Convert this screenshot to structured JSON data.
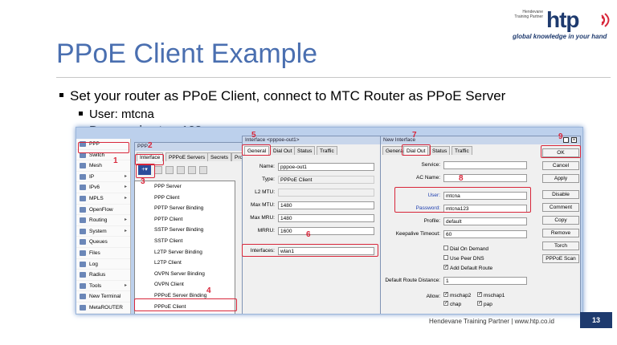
{
  "logo": {
    "small_text": "Hendevane Training Partner",
    "brand": "htp",
    "tagline": "global knowledge in your hand"
  },
  "slide": {
    "title": "PPoE Client Example",
    "bullets": [
      "Set your router as PPoE Client, connect to MTC Router as PPoE Server",
      "User: mtcna",
      "Password: mtcna123"
    ],
    "footer": "Hendevane Training Partner | www.htp.co.id",
    "page_number": "13"
  },
  "sidebar": {
    "items": [
      {
        "label": "PPP",
        "arrow": ""
      },
      {
        "label": "Switch",
        "arrow": ""
      },
      {
        "label": "Mesh",
        "arrow": ""
      },
      {
        "label": "IP",
        "arrow": "▸"
      },
      {
        "label": "IPv6",
        "arrow": "▸"
      },
      {
        "label": "MPLS",
        "arrow": "▸"
      },
      {
        "label": "OpenFlow",
        "arrow": ""
      },
      {
        "label": "Routing",
        "arrow": "▸"
      },
      {
        "label": "System",
        "arrow": "▸"
      },
      {
        "label": "Queues",
        "arrow": ""
      },
      {
        "label": "Files",
        "arrow": ""
      },
      {
        "label": "Log",
        "arrow": ""
      },
      {
        "label": "Radius",
        "arrow": ""
      },
      {
        "label": "Tools",
        "arrow": "▸"
      },
      {
        "label": "New Terminal",
        "arrow": ""
      },
      {
        "label": "MetaROUTER",
        "arrow": ""
      }
    ]
  },
  "ppp_window": {
    "title": "PPP",
    "tabs": [
      "Interface",
      "PPPoE Servers",
      "Secrets",
      "Pro"
    ],
    "add_label": "+▾",
    "dropdown": [
      "PPP Server",
      "PPP Client",
      "PPTP Server Binding",
      "PPTP Client",
      "SSTP Server Binding",
      "SSTP Client",
      "L2TP Server Binding",
      "L2TP Client",
      "OVPN Server Binding",
      "OVPN Client",
      "PPPoE Server Binding",
      "PPPoE Client"
    ]
  },
  "iface_window": {
    "title": "Interface <pppoe-out1>",
    "tabs": [
      "General",
      "Dial Out",
      "Status",
      "Traffic"
    ],
    "fields": [
      {
        "label": "Name:",
        "value": "pppoe-out1"
      },
      {
        "label": "Type:",
        "value": "PPPoE Client"
      },
      {
        "label": "L2 MTU:",
        "value": ""
      },
      {
        "label": "Max MTU:",
        "value": "1480"
      },
      {
        "label": "Max MRU:",
        "value": "1480"
      },
      {
        "label": "MRRU:",
        "value": "1600"
      }
    ],
    "interfaces_label": "Interfaces:",
    "interfaces_value": "wlan1"
  },
  "new_window": {
    "title": "New Interface",
    "tabs": [
      "General",
      "Dial Out",
      "Status",
      "Traffic"
    ],
    "service_label": "Service:",
    "ac_label": "AC Name:",
    "user_label": "User:",
    "user_value": "mtcna",
    "password_label": "Password:",
    "password_value": "mtcna123",
    "profile_label": "Profile:",
    "profile_value": "default",
    "keepalive_label": "Keepalive Timeout:",
    "keepalive_value": "60",
    "dial_on_demand": "Dial On Demand",
    "use_peer_dns": "Use Peer DNS",
    "add_default_route": "Add Default Route",
    "route_distance_label": "Default Route Distance:",
    "route_distance_value": "1",
    "allow_label": "Allow:",
    "allow": [
      "mschap2",
      "mschap1",
      "chap",
      "pap"
    ]
  },
  "buttons": [
    "OK",
    "Cancel",
    "Apply",
    "Disable",
    "Comment",
    "Copy",
    "Remove",
    "Torch",
    "PPPoE Scan"
  ],
  "steps": [
    "1",
    "2",
    "3",
    "4",
    "5",
    "6",
    "7",
    "8",
    "9"
  ]
}
